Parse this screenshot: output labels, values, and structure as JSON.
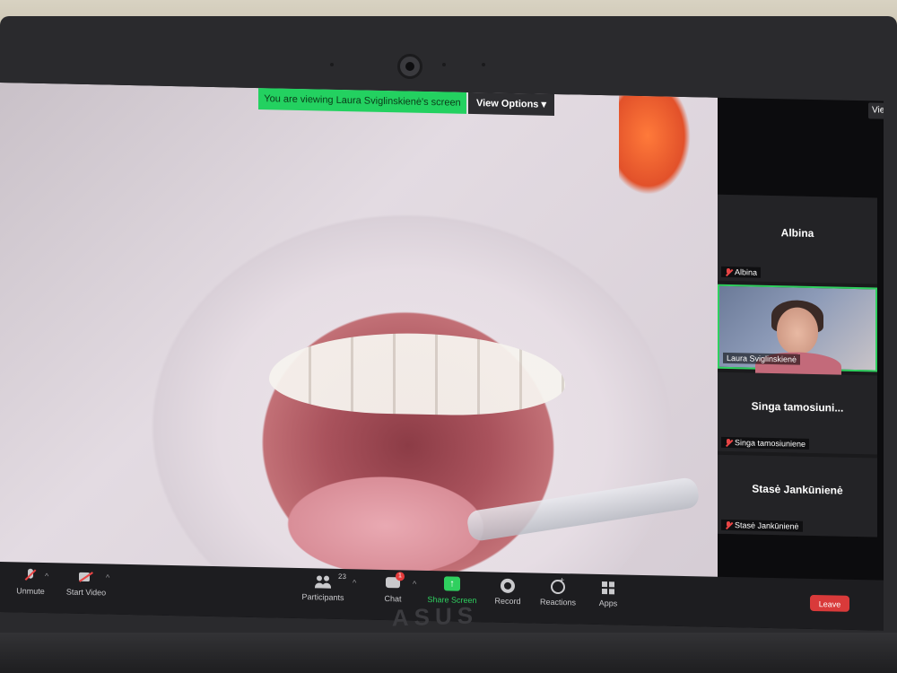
{
  "banner": {
    "viewing_text": "You are viewing Laura Sviglinskienė's screen",
    "view_options_label": "View Options",
    "view_topright_label": "View"
  },
  "gallery": {
    "tiles": [
      {
        "center_name": "Albina",
        "corner_name": "Albina",
        "muted": true
      },
      {
        "corner_name": "Laura Sviglinskienė",
        "video": true
      },
      {
        "center_name": "Singa tamosiuni...",
        "corner_name": "Singa tamosiuniene",
        "muted": true
      },
      {
        "center_name": "Stasė Jankūnienė",
        "corner_name": "Stasė Jankūnienė",
        "muted": true
      }
    ]
  },
  "toolbar": {
    "unmute_label": "Unmute",
    "start_video_label": "Start Video",
    "participants_label": "Participants",
    "participants_count": "23",
    "chat_label": "Chat",
    "chat_badge": "1",
    "share_screen_label": "Share Screen",
    "record_label": "Record",
    "reactions_label": "Reactions",
    "apps_label": "Apps",
    "leave_label": "Leave",
    "share_color": "#2fd05f",
    "leave_color": "#d93a3a"
  },
  "device": {
    "brand": "ASUS"
  }
}
